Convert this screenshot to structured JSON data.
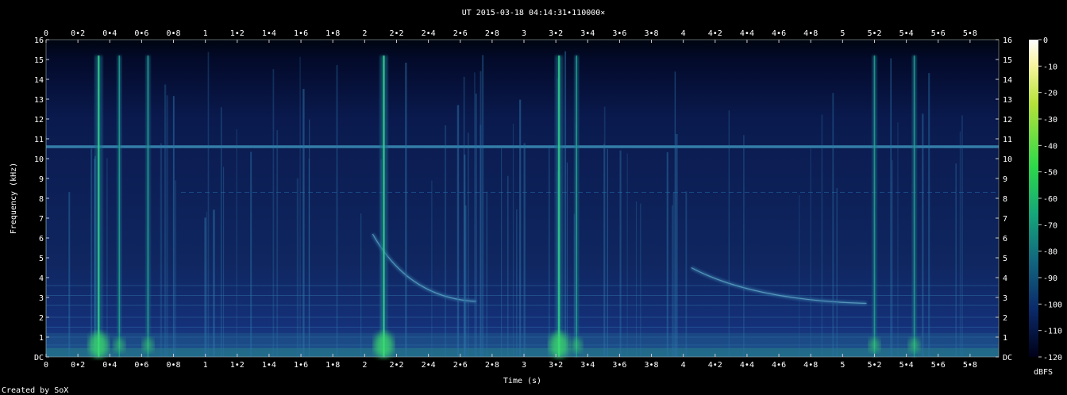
{
  "chart_data": {
    "type": "heatmap",
    "title": "UT 2015-03-18 04:14:31•110000×",
    "xlabel": "Time (s)",
    "ylabel": "Frequency (kHz)",
    "footer": "Created by SoX",
    "xlim": [
      0,
      5.98
    ],
    "ylim": [
      0,
      16
    ],
    "x_ticks": [
      "0",
      "0•2",
      "0•4",
      "0•6",
      "0•8",
      "1",
      "1•2",
      "1•4",
      "1•6",
      "1•8",
      "2",
      "2•2",
      "2•4",
      "2•6",
      "2•8",
      "3",
      "3•2",
      "3•4",
      "3•6",
      "3•8",
      "4",
      "4•2",
      "4•4",
      "4•6",
      "4•8",
      "5",
      "5•2",
      "5•4",
      "5•6",
      "5•8"
    ],
    "y_ticks": [
      "DC",
      "1",
      "2",
      "3",
      "4",
      "5",
      "6",
      "7",
      "8",
      "9",
      "10",
      "11",
      "12",
      "13",
      "14",
      "15",
      "16"
    ],
    "colorbar": {
      "unit": "dBFS",
      "range": [
        -120,
        0
      ],
      "ticks": [
        "0",
        "-10",
        "-20",
        "-30",
        "-40",
        "-50",
        "-60",
        "-70",
        "-80",
        "-90",
        "-100",
        "-110",
        "-120"
      ]
    },
    "features": {
      "horizontal_tone_khz": 10.6,
      "broadband_clicks_s": [
        0.33,
        0.46,
        0.64,
        2.12,
        3.22,
        3.33,
        5.2,
        5.45
      ],
      "descending_whistles": [
        {
          "t_start": 2.05,
          "f_start_khz": 6.2,
          "t_end": 2.7,
          "f_end_khz": 2.8
        },
        {
          "t_start": 4.05,
          "f_start_khz": 4.5,
          "t_end": 5.15,
          "f_end_khz": 2.7
        }
      ]
    }
  },
  "colors": {
    "background": "#000000",
    "plot_base": "#0b1d52",
    "tone": "#3a8fb8",
    "bright": "#39d98a",
    "text": "#ffffff"
  }
}
